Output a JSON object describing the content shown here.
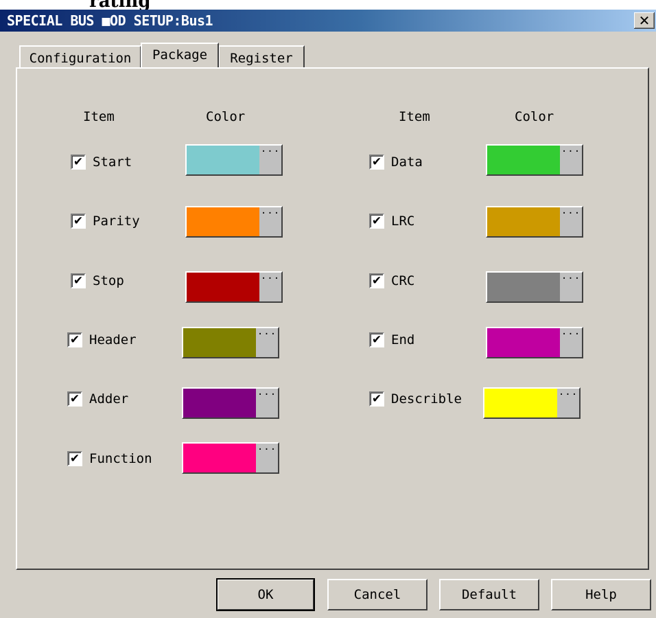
{
  "caption_fragment": "rating",
  "window": {
    "title": "SPECIAL BUS ■OD SETUP:Bus1",
    "close_glyph": "✕"
  },
  "tabs": [
    {
      "label": "Configuration",
      "active": false
    },
    {
      "label": "Package",
      "active": true
    },
    {
      "label": "Register",
      "active": false
    }
  ],
  "headers": {
    "left_item": "Item",
    "left_color": "Color",
    "right_item": "Item",
    "right_color": "Color"
  },
  "check_glyph": "✔",
  "color_button_dots": "···",
  "left_items": [
    {
      "label": "Start",
      "checked": true,
      "color": "#7ecbce"
    },
    {
      "label": "Parity",
      "checked": true,
      "color": "#ff8000"
    },
    {
      "label": "Stop",
      "checked": true,
      "color": "#b30000"
    },
    {
      "label": "Header",
      "checked": true,
      "color": "#808000"
    },
    {
      "label": "Adder",
      "checked": true,
      "color": "#800080"
    },
    {
      "label": "Function",
      "checked": true,
      "color": "#ff0080"
    }
  ],
  "right_items": [
    {
      "label": "Data",
      "checked": true,
      "color": "#33cc33"
    },
    {
      "label": "LRC",
      "checked": true,
      "color": "#cc9900"
    },
    {
      "label": "CRC",
      "checked": true,
      "color": "#808080"
    },
    {
      "label": "End",
      "checked": true,
      "color": "#c000a0"
    },
    {
      "label": "Describle",
      "checked": true,
      "color": "#ffff00"
    }
  ],
  "buttons": {
    "ok": "OK",
    "cancel": "Cancel",
    "default": "Default",
    "help": "Help"
  },
  "colors": {
    "face": "#d4d0c8",
    "title_start": "#0a246a",
    "title_end": "#a6caf0"
  }
}
